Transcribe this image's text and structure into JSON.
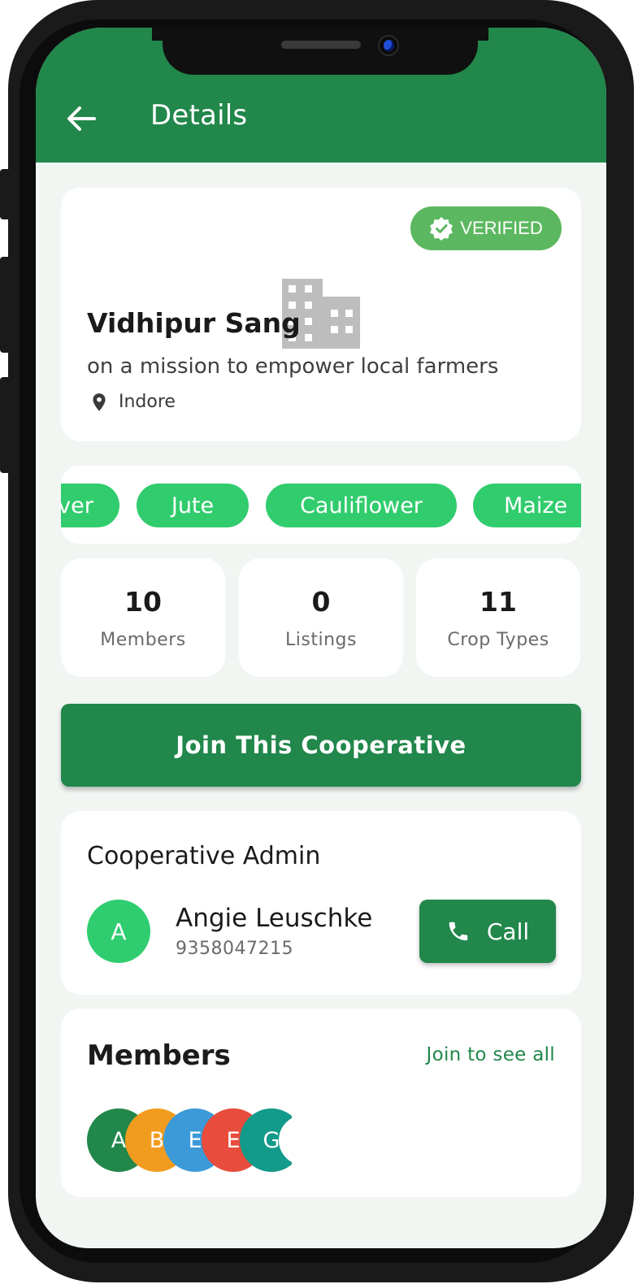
{
  "app_bar": {
    "title": "Details",
    "back_icon": "arrow-left-icon"
  },
  "cooperative": {
    "verified_label": "VERIFIED",
    "name": "Vidhipur Sang",
    "tagline": "on a mission to empower local farmers",
    "location": "Indore"
  },
  "crops": [
    "ver",
    "Jute",
    "Cauliflower",
    "Maize"
  ],
  "stats": [
    {
      "value": "10",
      "label": "Members"
    },
    {
      "value": "0",
      "label": "Listings"
    },
    {
      "value": "11",
      "label": "Crop Types"
    }
  ],
  "join_button": "Join This Cooperative",
  "admin": {
    "heading": "Cooperative Admin",
    "initial": "A",
    "name": "Angie Leuschke",
    "phone": "9358047215",
    "call_label": "Call"
  },
  "members": {
    "heading": "Members",
    "join_to_see_all": "Join to see all",
    "avatars": [
      {
        "initial": "A",
        "color": "#21874b"
      },
      {
        "initial": "B",
        "color": "#f29c1f"
      },
      {
        "initial": "E",
        "color": "#3c9ad9"
      },
      {
        "initial": "E",
        "color": "#e74c3c"
      },
      {
        "initial": "G",
        "color": "#129a8a"
      }
    ]
  },
  "colors": {
    "primary": "#21874b",
    "chip": "#31cc6d",
    "verified": "#5cb860",
    "background": "#f1f6f3"
  }
}
